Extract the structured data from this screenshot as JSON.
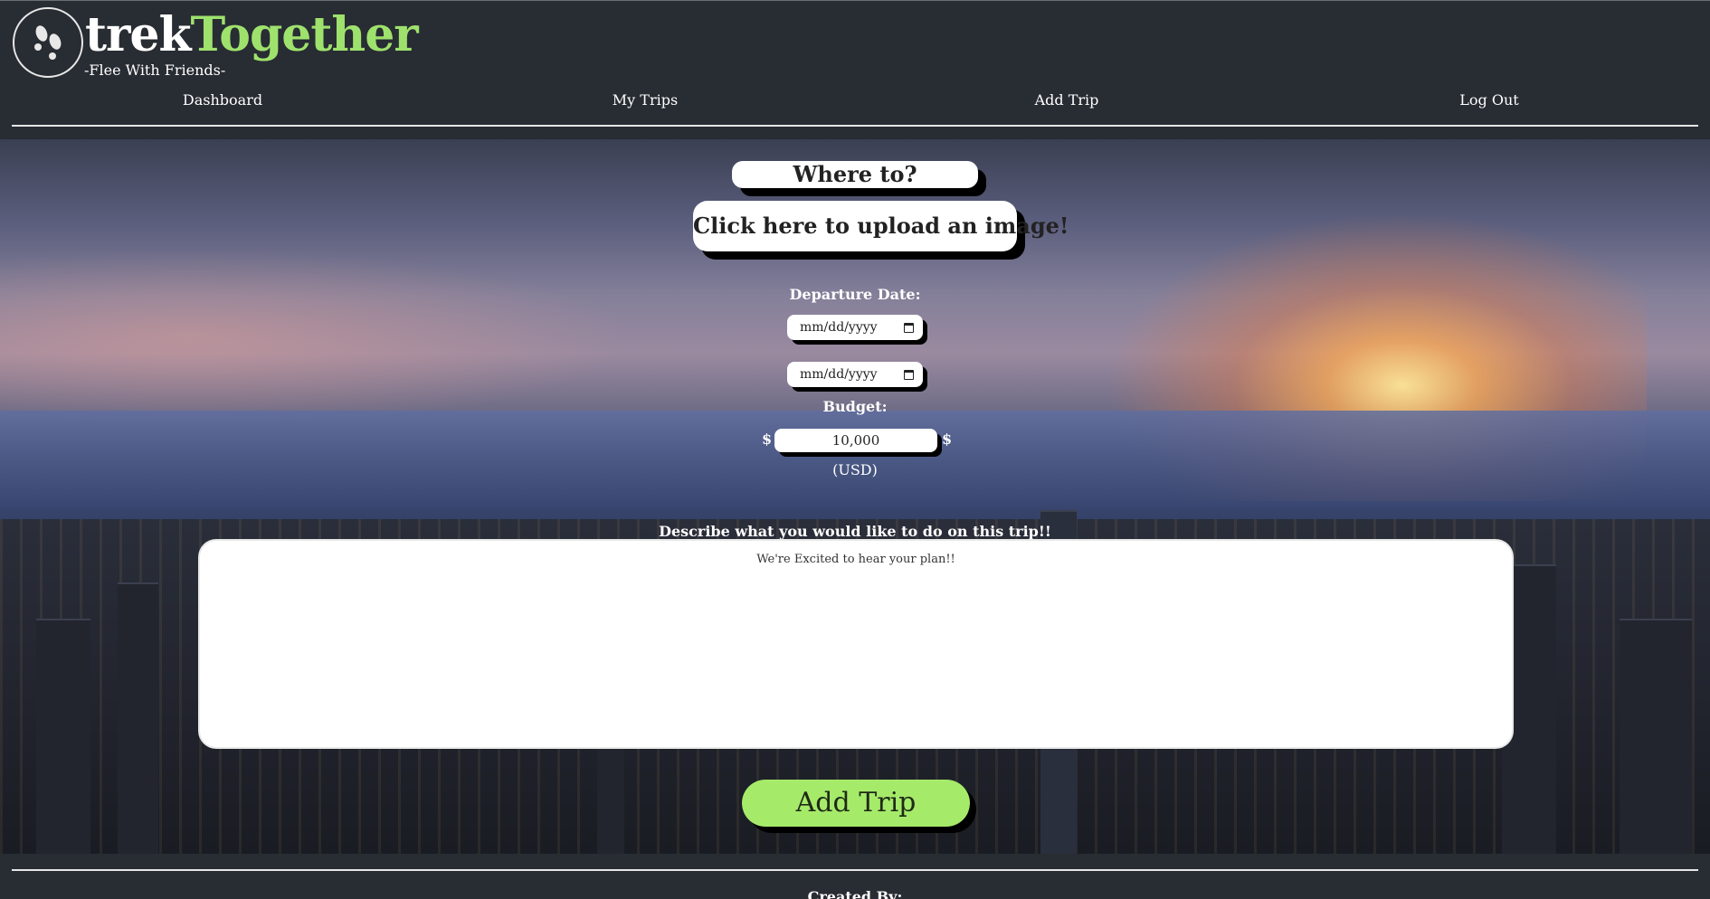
{
  "brand": {
    "name_white": "trek",
    "name_green": "Together",
    "tagline": "-Flee With Friends-"
  },
  "nav": {
    "items": [
      "Dashboard",
      "My Trips",
      "Add Trip",
      "Log Out"
    ]
  },
  "form": {
    "destination_placeholder": "Where to?",
    "upload_label": "Click here to upload an image!",
    "departure_label": "Departure Date:",
    "departure_placeholder": "mm/dd/yyyy",
    "return_placeholder": "mm/dd/yyyy",
    "budget_label": "Budget:",
    "currency_symbol": "$",
    "budget_value": "10,000",
    "currency_note": "(USD)",
    "description_label": "Describe what you would like to do on this trip!!",
    "description_placeholder": "We're Excited to hear your plan!!",
    "submit_label": "Add Trip"
  },
  "footer": {
    "title": "Created By:"
  },
  "colors": {
    "header_bg": "#282c33",
    "accent_green": "#9ee26d",
    "button_green": "#a6ea6a"
  }
}
